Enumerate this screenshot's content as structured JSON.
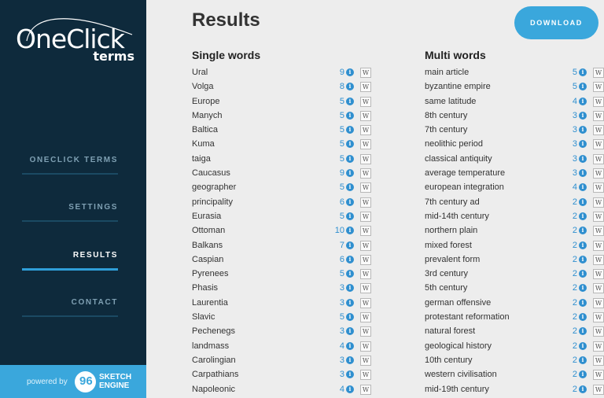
{
  "brand": {
    "name": "OneClick",
    "sub": "terms"
  },
  "nav": [
    {
      "label": "ONECLICK TERMS",
      "active": false
    },
    {
      "label": "SETTINGS",
      "active": false
    },
    {
      "label": "RESULTS",
      "active": true
    },
    {
      "label": "CONTACT",
      "active": false
    }
  ],
  "footer": {
    "powered_by": "powered by",
    "logo_glyph": "96",
    "engine_line1": "SKETCH",
    "engine_line2": "ENGINE"
  },
  "page": {
    "title": "Results",
    "download_label": "DOWNLOAD"
  },
  "icons": {
    "info": "i",
    "wiki": "W"
  },
  "single_words": {
    "title": "Single words",
    "rows": [
      {
        "term": "Ural",
        "count": "9"
      },
      {
        "term": "Volga",
        "count": "8"
      },
      {
        "term": "Europe",
        "count": "5"
      },
      {
        "term": "Manych",
        "count": "5"
      },
      {
        "term": "Baltica",
        "count": "5"
      },
      {
        "term": "Kuma",
        "count": "5"
      },
      {
        "term": "taiga",
        "count": "5"
      },
      {
        "term": "Caucasus",
        "count": "9"
      },
      {
        "term": "geographer",
        "count": "5"
      },
      {
        "term": "principality",
        "count": "6"
      },
      {
        "term": "Eurasia",
        "count": "5"
      },
      {
        "term": "Ottoman",
        "count": "10"
      },
      {
        "term": "Balkans",
        "count": "7"
      },
      {
        "term": "Caspian",
        "count": "6"
      },
      {
        "term": "Pyrenees",
        "count": "5"
      },
      {
        "term": "Phasis",
        "count": "3"
      },
      {
        "term": "Laurentia",
        "count": "3"
      },
      {
        "term": "Slavic",
        "count": "5"
      },
      {
        "term": "Pechenegs",
        "count": "3"
      },
      {
        "term": "landmass",
        "count": "4"
      },
      {
        "term": "Carolingian",
        "count": "3"
      },
      {
        "term": "Carpathians",
        "count": "3"
      },
      {
        "term": "Napoleonic",
        "count": "4"
      }
    ]
  },
  "multi_words": {
    "title": "Multi words",
    "rows": [
      {
        "term": "main article",
        "count": "5"
      },
      {
        "term": "byzantine empire",
        "count": "5"
      },
      {
        "term": "same latitude",
        "count": "4"
      },
      {
        "term": "8th century",
        "count": "3"
      },
      {
        "term": "7th century",
        "count": "3"
      },
      {
        "term": "neolithic period",
        "count": "3"
      },
      {
        "term": "classical antiquity",
        "count": "3"
      },
      {
        "term": "average temperature",
        "count": "3"
      },
      {
        "term": "european integration",
        "count": "4"
      },
      {
        "term": "7th century ad",
        "count": "2"
      },
      {
        "term": "mid-14th century",
        "count": "2"
      },
      {
        "term": "northern plain",
        "count": "2"
      },
      {
        "term": "mixed forest",
        "count": "2"
      },
      {
        "term": "prevalent form",
        "count": "2"
      },
      {
        "term": "3rd century",
        "count": "2"
      },
      {
        "term": "5th century",
        "count": "2"
      },
      {
        "term": "german offensive",
        "count": "2"
      },
      {
        "term": "protestant reformation",
        "count": "2"
      },
      {
        "term": "natural forest",
        "count": "2"
      },
      {
        "term": "geological history",
        "count": "2"
      },
      {
        "term": "10th century",
        "count": "2"
      },
      {
        "term": "western civilisation",
        "count": "2"
      },
      {
        "term": "mid-19th century",
        "count": "2"
      }
    ]
  }
}
